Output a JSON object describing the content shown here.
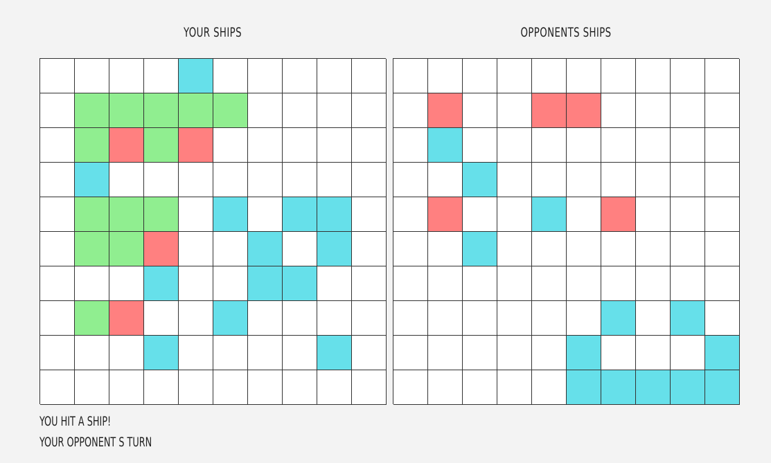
{
  "players": [
    {
      "title": "YOUR SHIPS",
      "grid": [
        "....m.....",
        ".sssss....",
        ".shsh.....",
        ".m........",
        ".sss.m.mm.",
        ".ssh..m.m.",
        "...m..mm..",
        ".sh..m....",
        "...m....m.",
        ".........."
      ]
    },
    {
      "title": "OPPONENTS SHIPS",
      "grid": [
        "..........",
        ".h..hh....",
        ".m........",
        "..m.......",
        ".h..m.h...",
        "..m.......",
        "..........",
        "......m.m.",
        ".....m...m",
        ".....mmmmm"
      ]
    }
  ],
  "cell_legend": {
    ".": "empty",
    "s": "ship",
    "h": "hit",
    "m": "miss"
  },
  "colors": {
    "background": "#f3f3f3",
    "cell": "#ffffff",
    "ship": "#90ee90",
    "hit": "#ff8080",
    "miss": "#66e0ea",
    "grid_line": "#333333"
  },
  "status": {
    "line1": "YOU HIT A SHIP!",
    "line2": "YOUR OPPONENT S TURN"
  }
}
